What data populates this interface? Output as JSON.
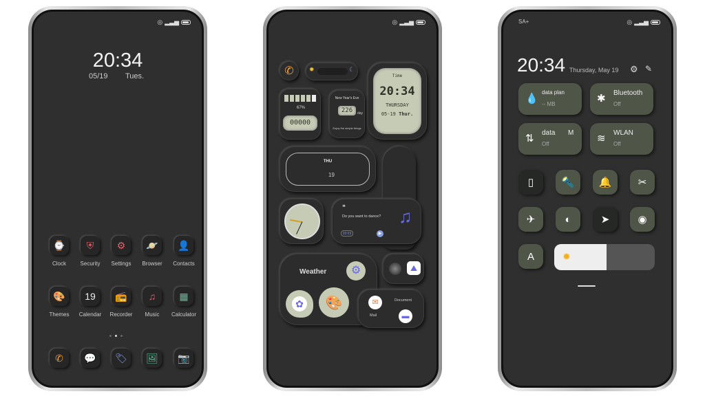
{
  "status": {
    "carrier": "SA+"
  },
  "home": {
    "time": "20:34",
    "date": "05/19",
    "weekday": "Tues.",
    "apps": [
      {
        "label": "Clock",
        "icon": "watch-icon",
        "glyph": "⌚",
        "color": "#5fbf9a"
      },
      {
        "label": "Security",
        "icon": "shield-icon",
        "glyph": "⛨",
        "color": "#e5606a"
      },
      {
        "label": "Settings",
        "icon": "gear-icon",
        "glyph": "⚙",
        "color": "#e5606a"
      },
      {
        "label": "Browser",
        "icon": "planet-icon",
        "glyph": "🪐",
        "color": "#5a78d8"
      },
      {
        "label": "Contacts",
        "icon": "contacts-icon",
        "glyph": "👤",
        "color": "#3d56a8"
      },
      {
        "label": "Themes",
        "icon": "palette-icon",
        "glyph": "🎨",
        "color": "#e8e8f0"
      },
      {
        "label": "Calendar",
        "icon": "calendar-icon",
        "glyph": "19",
        "color": "#eeeeee"
      },
      {
        "label": "Recorder",
        "icon": "radio-icon",
        "glyph": "📻",
        "color": "#eeeeee"
      },
      {
        "label": "Music",
        "icon": "music-note-icon",
        "glyph": "♫",
        "color": "#e5606a"
      },
      {
        "label": "Calculator",
        "icon": "calculator-icon",
        "glyph": "▦",
        "color": "#5fbf9a"
      }
    ],
    "dock": [
      {
        "icon": "phone-icon",
        "glyph": "✆",
        "color": "#f0a040"
      },
      {
        "icon": "message-icon",
        "glyph": "💬",
        "color": "#e5606a"
      },
      {
        "icon": "tag-icon",
        "glyph": "🏷",
        "color": "#8aa0e0"
      },
      {
        "icon": "gallery-icon",
        "glyph": "🖼",
        "color": "#5fbf9a"
      },
      {
        "icon": "camera-icon",
        "glyph": "📷",
        "color": "#4a68c8"
      }
    ]
  },
  "widgets": {
    "time_label": "Time",
    "lcd_time": "20:34",
    "lcd_day": "THURSDAY",
    "lcd_date": "05-19",
    "lcd_wd": "Thur.",
    "battery": "67%",
    "steps": "00000",
    "event": "New Year's Eve",
    "days": "226",
    "days_unit": "day",
    "event_sub": "Enjoy the simple things",
    "cal_day": "THU",
    "cal_date": "19",
    "quote": "Do you want to dance?",
    "music_time": "03:03",
    "weather": "Weather",
    "mail": "Mail",
    "document": "Document"
  },
  "qs": {
    "time": "20:34",
    "date": "Thursday, May 19",
    "tiles": [
      {
        "title": "data plan",
        "sub": "-- MB",
        "icon": "water-drop-icon",
        "glyph": "💧"
      },
      {
        "title": "Bluetooth",
        "sub": "Off",
        "icon": "bluetooth-icon",
        "glyph": "✱"
      },
      {
        "title": "data",
        "extra": "M",
        "sub": "Off",
        "icon": "data-arrows-icon",
        "glyph": "⇅"
      },
      {
        "title": "WLAN",
        "sub": "Off",
        "icon": "wifi-icon",
        "glyph": "≋"
      }
    ],
    "toggles": [
      {
        "icon": "vibrate-icon",
        "glyph": "▯",
        "active": true
      },
      {
        "icon": "flashlight-icon",
        "glyph": "🔦",
        "active": false
      },
      {
        "icon": "bell-icon",
        "glyph": "🔔",
        "active": false
      },
      {
        "icon": "screenshot-icon",
        "glyph": "✂",
        "active": false
      },
      {
        "icon": "airplane-icon",
        "glyph": "✈",
        "active": false
      },
      {
        "icon": "contrast-icon",
        "glyph": "◐",
        "active": false
      },
      {
        "icon": "location-icon",
        "glyph": "➤",
        "active": true
      },
      {
        "icon": "eye-icon",
        "glyph": "◉",
        "active": false
      }
    ],
    "auto_brightness": "A",
    "brightness": 0.52
  }
}
